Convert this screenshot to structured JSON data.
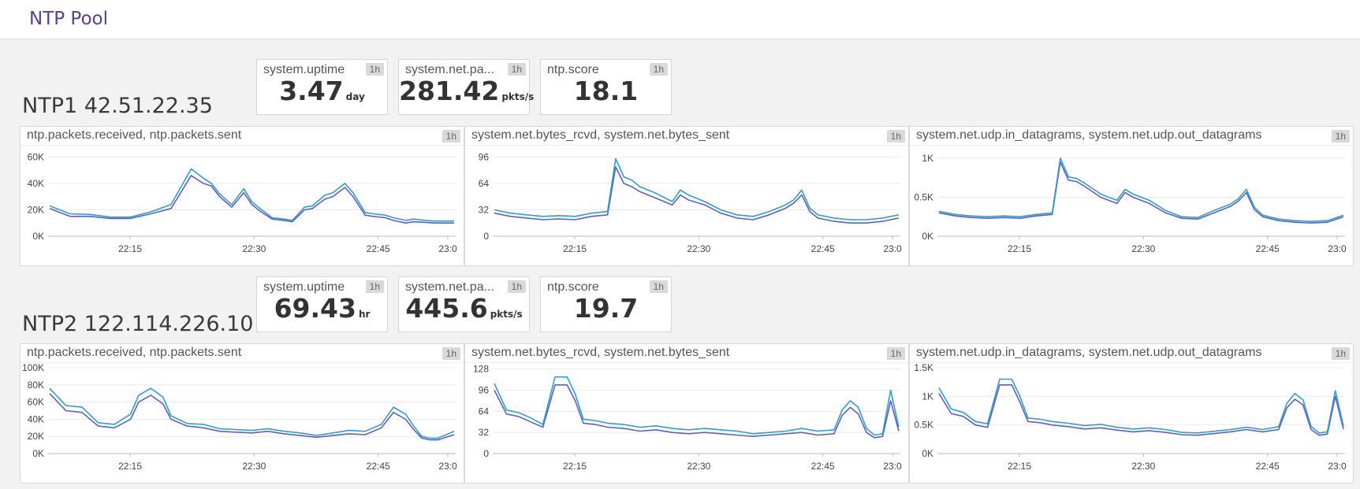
{
  "app": {
    "title": "NTP Pool",
    "time_window": "1h"
  },
  "colors": {
    "received": "#6b5bb5",
    "sent": "#2a9ed6",
    "grid": "#ececec"
  },
  "hosts": [
    {
      "name": "NTP1 42.51.22.35",
      "query_values": [
        {
          "metric": "system.uptime",
          "value": "3.47",
          "unit": "day"
        },
        {
          "metric": "system.net.pa...",
          "value": "281.42",
          "unit": "pkts/s"
        },
        {
          "metric": "ntp.score",
          "value": "18.1",
          "unit": ""
        }
      ],
      "graphs": [
        {
          "title": "ntp.packets.received, ntp.packets.sent"
        },
        {
          "title": "system.net.bytes_rcvd, system.net.bytes_sent"
        },
        {
          "title": "system.net.udp.in_datagrams, system.net.udp.out_datagrams"
        }
      ]
    },
    {
      "name": "NTP2 122.114.226.10",
      "query_values": [
        {
          "metric": "system.uptime",
          "value": "69.43",
          "unit": "hr"
        },
        {
          "metric": "system.net.pa...",
          "value": "445.6",
          "unit": "pkts/s"
        },
        {
          "metric": "ntp.score",
          "value": "19.7",
          "unit": ""
        }
      ],
      "graphs": [
        {
          "title": "ntp.packets.received, ntp.packets.sent"
        },
        {
          "title": "system.net.bytes_rcvd, system.net.bytes_sent"
        },
        {
          "title": "system.net.udp.in_datagrams, system.net.udp.out_datagrams"
        }
      ]
    }
  ],
  "chart_data": [
    {
      "type": "line",
      "host": "NTP1",
      "x_ticks": [
        "22:15",
        "22:30",
        "22:45",
        "23:0"
      ],
      "y_ticks": [
        "0K",
        "20K",
        "40K",
        "60K"
      ],
      "ylim": [
        0,
        65000
      ],
      "x": [
        0,
        0.05,
        0.1,
        0.15,
        0.2,
        0.25,
        0.3,
        0.35,
        0.38,
        0.4,
        0.42,
        0.45,
        0.48,
        0.5,
        0.52,
        0.55,
        0.58,
        0.6,
        0.63,
        0.65,
        0.68,
        0.7,
        0.73,
        0.75,
        0.78,
        0.8,
        0.83,
        0.85,
        0.88,
        0.9,
        0.93,
        0.95,
        0.98,
        1.0
      ],
      "series": [
        {
          "values": [
            21000,
            15000,
            15000,
            13500,
            13500,
            17000,
            21000,
            46000,
            40000,
            38000,
            30000,
            22000,
            33000,
            24000,
            19000,
            13000,
            12000,
            11000,
            20000,
            21000,
            28000,
            30000,
            37000,
            30000,
            16000,
            15000,
            14000,
            12000,
            10000,
            11000,
            10500,
            10000,
            10000,
            10000
          ]
        },
        {
          "values": [
            23000,
            17000,
            16500,
            14500,
            14500,
            18500,
            24000,
            51000,
            44000,
            40000,
            32000,
            24000,
            36000,
            26000,
            21000,
            14000,
            13000,
            12000,
            22000,
            23000,
            31000,
            33000,
            40000,
            33000,
            18000,
            17000,
            16000,
            14000,
            12000,
            13000,
            12000,
            11500,
            11500,
            11500
          ]
        }
      ]
    },
    {
      "type": "line",
      "host": "NTP1",
      "x_ticks": [
        "22:15",
        "22:30",
        "22:45",
        "23:0"
      ],
      "y_ticks": [
        "0",
        "32",
        "64",
        "96"
      ],
      "ylim": [
        0,
        104
      ],
      "x": [
        0,
        0.04,
        0.08,
        0.12,
        0.16,
        0.2,
        0.24,
        0.28,
        0.3,
        0.32,
        0.34,
        0.36,
        0.4,
        0.44,
        0.46,
        0.48,
        0.52,
        0.56,
        0.6,
        0.64,
        0.68,
        0.7,
        0.72,
        0.74,
        0.76,
        0.78,
        0.8,
        0.84,
        0.88,
        0.92,
        0.96,
        1.0
      ],
      "series": [
        {
          "values": [
            28,
            24,
            22,
            20,
            21,
            20,
            24,
            26,
            84,
            64,
            60,
            54,
            46,
            38,
            50,
            44,
            38,
            28,
            22,
            20,
            26,
            30,
            34,
            40,
            50,
            30,
            22,
            18,
            16,
            16,
            18,
            22
          ]
        },
        {
          "values": [
            32,
            28,
            26,
            24,
            25,
            24,
            28,
            30,
            94,
            72,
            68,
            60,
            52,
            42,
            56,
            50,
            42,
            32,
            26,
            24,
            30,
            34,
            38,
            44,
            56,
            34,
            26,
            22,
            20,
            20,
            22,
            26
          ]
        }
      ]
    },
    {
      "type": "line",
      "host": "NTP1",
      "x_ticks": [
        "22:15",
        "22:30",
        "22:45",
        "23:0"
      ],
      "y_ticks": [
        "0K",
        "0.5K",
        "1K"
      ],
      "ylim": [
        0,
        1100
      ],
      "x": [
        0,
        0.04,
        0.08,
        0.12,
        0.16,
        0.2,
        0.24,
        0.28,
        0.3,
        0.32,
        0.34,
        0.36,
        0.4,
        0.44,
        0.46,
        0.48,
        0.52,
        0.56,
        0.6,
        0.64,
        0.68,
        0.7,
        0.72,
        0.74,
        0.76,
        0.78,
        0.8,
        0.84,
        0.88,
        0.92,
        0.96,
        1.0
      ],
      "series": [
        {
          "values": [
            300,
            260,
            240,
            230,
            240,
            230,
            260,
            280,
            950,
            720,
            700,
            640,
            500,
            420,
            560,
            500,
            420,
            300,
            230,
            220,
            300,
            340,
            380,
            450,
            560,
            340,
            250,
            200,
            180,
            170,
            180,
            250
          ]
        },
        {
          "values": [
            320,
            280,
            260,
            250,
            260,
            250,
            280,
            300,
            1000,
            760,
            740,
            680,
            540,
            460,
            600,
            540,
            460,
            330,
            250,
            240,
            330,
            370,
            410,
            480,
            600,
            370,
            270,
            220,
            200,
            190,
            200,
            270
          ]
        }
      ]
    },
    {
      "type": "line",
      "host": "NTP2",
      "x_ticks": [
        "22:15",
        "22:30",
        "22:45",
        "23:0"
      ],
      "y_ticks": [
        "0K",
        "20K",
        "40K",
        "60K",
        "80K",
        "100K"
      ],
      "ylim": [
        0,
        100000
      ],
      "x": [
        0,
        0.04,
        0.08,
        0.12,
        0.16,
        0.2,
        0.22,
        0.25,
        0.28,
        0.3,
        0.34,
        0.38,
        0.42,
        0.46,
        0.5,
        0.54,
        0.58,
        0.62,
        0.66,
        0.7,
        0.74,
        0.78,
        0.8,
        0.82,
        0.85,
        0.88,
        0.9,
        0.92,
        0.94,
        0.96,
        1.0
      ],
      "series": [
        {
          "values": [
            70000,
            50000,
            48000,
            32000,
            30000,
            40000,
            60000,
            68000,
            58000,
            40000,
            32000,
            30000,
            26000,
            25000,
            24000,
            26000,
            23000,
            21000,
            19000,
            21000,
            23000,
            22000,
            26000,
            30000,
            48000,
            40000,
            28000,
            18000,
            16000,
            16000,
            22000
          ]
        },
        {
          "values": [
            76000,
            56000,
            54000,
            36000,
            34000,
            46000,
            68000,
            76000,
            66000,
            44000,
            35000,
            34000,
            29000,
            28000,
            27000,
            29000,
            26000,
            24000,
            21000,
            24000,
            27000,
            26000,
            30000,
            34000,
            54000,
            46000,
            32000,
            20000,
            18000,
            18000,
            26000
          ]
        }
      ]
    },
    {
      "type": "line",
      "host": "NTP2",
      "x_ticks": [
        "22:15",
        "22:30",
        "22:45",
        "23:0"
      ],
      "y_ticks": [
        "0",
        "32",
        "64",
        "96",
        "128"
      ],
      "ylim": [
        0,
        130
      ],
      "x": [
        0,
        0.03,
        0.06,
        0.09,
        0.12,
        0.15,
        0.18,
        0.2,
        0.22,
        0.25,
        0.28,
        0.32,
        0.36,
        0.4,
        0.44,
        0.48,
        0.52,
        0.56,
        0.6,
        0.64,
        0.68,
        0.72,
        0.76,
        0.8,
        0.84,
        0.86,
        0.88,
        0.9,
        0.92,
        0.94,
        0.96,
        0.98,
        1.0
      ],
      "series": [
        {
          "values": [
            96,
            60,
            56,
            48,
            40,
            104,
            104,
            80,
            46,
            44,
            40,
            38,
            34,
            36,
            32,
            30,
            32,
            30,
            28,
            26,
            28,
            30,
            32,
            28,
            30,
            58,
            70,
            60,
            32,
            24,
            26,
            80,
            34
          ]
        },
        {
          "values": [
            106,
            66,
            62,
            54,
            44,
            116,
            116,
            90,
            52,
            50,
            46,
            44,
            40,
            42,
            38,
            36,
            38,
            36,
            34,
            30,
            32,
            34,
            38,
            34,
            36,
            66,
            80,
            70,
            38,
            28,
            30,
            96,
            40
          ]
        }
      ]
    },
    {
      "type": "line",
      "host": "NTP2",
      "x_ticks": [
        "22:15",
        "22:30",
        "22:45",
        "23:0"
      ],
      "y_ticks": [
        "0K",
        "0.5K",
        "1K",
        "1.5K"
      ],
      "ylim": [
        0,
        1500
      ],
      "x": [
        0,
        0.03,
        0.06,
        0.09,
        0.12,
        0.15,
        0.18,
        0.2,
        0.22,
        0.25,
        0.28,
        0.32,
        0.36,
        0.4,
        0.44,
        0.48,
        0.52,
        0.56,
        0.6,
        0.64,
        0.68,
        0.72,
        0.76,
        0.8,
        0.84,
        0.86,
        0.88,
        0.9,
        0.92,
        0.94,
        0.96,
        0.98,
        1.0
      ],
      "series": [
        {
          "values": [
            1050,
            700,
            650,
            500,
            460,
            1200,
            1200,
            900,
            560,
            540,
            500,
            470,
            430,
            450,
            410,
            380,
            400,
            370,
            330,
            320,
            350,
            380,
            420,
            380,
            420,
            800,
            950,
            850,
            420,
            320,
            340,
            1000,
            430
          ]
        },
        {
          "values": [
            1150,
            780,
            720,
            560,
            520,
            1300,
            1300,
            1000,
            620,
            600,
            560,
            530,
            490,
            510,
            460,
            430,
            450,
            420,
            370,
            360,
            390,
            420,
            460,
            420,
            470,
            880,
            1050,
            940,
            470,
            360,
            380,
            1100,
            480
          ]
        }
      ]
    }
  ]
}
